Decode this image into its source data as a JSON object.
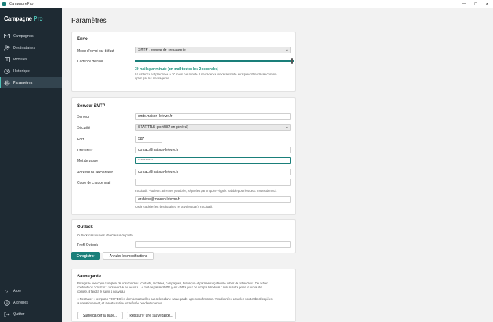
{
  "window": {
    "title": "CampagnePro",
    "minimize": "—",
    "maximize": "☐",
    "close": "✕"
  },
  "brand": {
    "name": "Campagne",
    "accent": "Pro"
  },
  "sidebar": {
    "items": [
      {
        "label": "Campagnes"
      },
      {
        "label": "Destinataires"
      },
      {
        "label": "Modèles"
      },
      {
        "label": "Historique"
      },
      {
        "label": "Paramètres"
      }
    ],
    "bottom": [
      {
        "label": "Aide"
      },
      {
        "label": "À propos"
      },
      {
        "label": "Quitter"
      }
    ]
  },
  "page": {
    "title": "Paramètres"
  },
  "envoi": {
    "title": "Envoi",
    "mode_label": "Mode d'envoi par défaut",
    "mode_value": "SMTP : serveur de messagerie",
    "cadence_label": "Cadence d'envoi",
    "cadence_fraction": 0.99,
    "rate_text": "30 mails par minute (un mail toutes les 2 secondes)",
    "hint_1": "La cadence est plafonnée à 30 mails par minute. Une cadence modérée limite le risque d'être classé comme",
    "hint_2": "spam par les messageries."
  },
  "smtp": {
    "title": "Serveur SMTP",
    "server_label": "Serveur",
    "server_value": "smtp.maison-lefevre.fr",
    "security_label": "Sécurité",
    "security_value": "STARTTLS (port 587 en général)",
    "port_label": "Port",
    "port_value": "587",
    "user_label": "Utilisateur",
    "user_value": "contact@maison-lefevre.fr",
    "password_label": "Mot de passe",
    "password_value": "••••••••••••",
    "sender_label": "Adresse de l'expéditeur",
    "sender_value": "contact@maison-lefevre.fr",
    "cc_label": "Copie de chaque mail",
    "cc_value": "",
    "cc_hint": "Facultatif. Plusieurs adresses possibles, séparées par un point-virgule. Valable pour les deux modes d'envoi.",
    "bcc_value": "archives@maison-lefevre.fr",
    "bcc_hint": "Copie cachée (les destinataires ne la voient pas). Facultatif."
  },
  "outlook": {
    "title": "Outlook",
    "note": "Outlook classique est détecté sur ce poste.",
    "profile_label": "Profil Outlook",
    "profile_value": ""
  },
  "actions": {
    "save": "Enregistrer",
    "cancel": "Annuler les modifications"
  },
  "backup": {
    "title": "Sauvegarde",
    "p1_1": "Enregistre une copie complète de vos données (contacts, modèles, campagnes, historique et paramètres) dans le fichier de votre choix. Ce fichier",
    "p1_2": "contient vos contacts : conservez-le en lieu sûr. Le mot de passe SMTP y est chiffré pour ce compte Windows : sur un autre poste ou un autre",
    "p1_3": "compte, il faudra le saisir à nouveau.",
    "p2_1": "« Restaurer » remplace TOUTES les données actuelles par celles d'une sauvegarde, après confirmation. Vos données actuelles sont d'abord copiées",
    "p2_2": "automatiquement, et la restauration est refusée pendant un envoi.",
    "save_btn": "Sauvegarder la base...",
    "restore_btn": "Restaurer une sauvegarde..."
  }
}
